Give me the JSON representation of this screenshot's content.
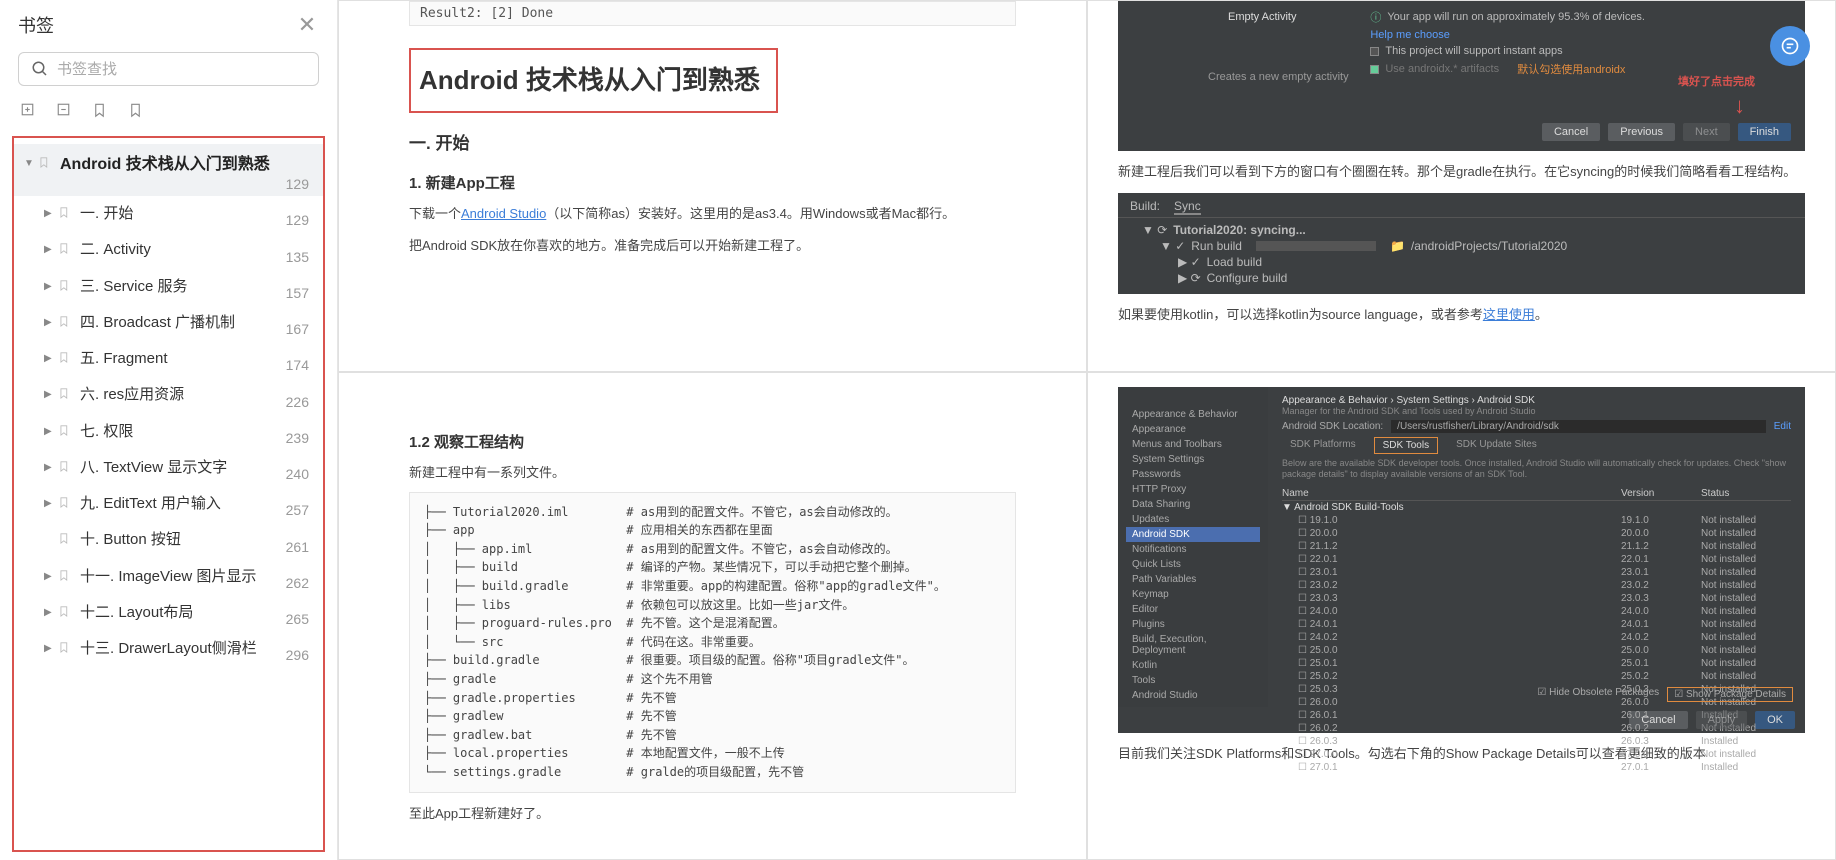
{
  "sidebar": {
    "title": "书签",
    "search_placeholder": "书签查找",
    "root": {
      "label": "Android 技术栈从入门到熟悉",
      "page": "129"
    },
    "items": [
      {
        "label": "一. 开始",
        "page": "129"
      },
      {
        "label": "二. Activity",
        "page": "135"
      },
      {
        "label": "三. Service 服务",
        "page": "157"
      },
      {
        "label": "四. Broadcast 广播机制",
        "page": "167"
      },
      {
        "label": "五. Fragment",
        "page": "174"
      },
      {
        "label": "六. res应用资源",
        "page": "226"
      },
      {
        "label": "七. 权限",
        "page": "239"
      },
      {
        "label": "八. TextView 显示文字",
        "page": "240"
      },
      {
        "label": "九. EditText 用户输入",
        "page": "257"
      },
      {
        "label": "十. Button 按钮",
        "page": "261",
        "noexpand": true
      },
      {
        "label": "十一. ImageView 图片显示",
        "page": "262"
      },
      {
        "label": "十二. Layout布局",
        "page": "265"
      },
      {
        "label": "十三. DrawerLayout侧滑栏",
        "page": "296"
      }
    ]
  },
  "article": {
    "code_result": "Result2: [2] Done",
    "title": "Android 技术栈从入门到熟悉",
    "h2_1": "一. 开始",
    "h3_1": "1. 新建App工程",
    "p1_a": "下载一个",
    "p1_link": "Android Studio",
    "p1_b": "（以下简称as）安装好。这里用的是as3.4。用Windows或者Mac都行。",
    "p2": "把Android SDK放在你喜欢的地方。准备完成后可以开始新建工程了。",
    "h3_2": "1.2 观察工程结构",
    "p3": "新建工程中有一系列文件。",
    "tree_text": "├── Tutorial2020.iml        # as用到的配置文件。不管它，as会自动修改的。\n├── app                     # 应用相关的东西都在里面\n│   ├── app.iml             # as用到的配置文件。不管它，as会自动修改的。\n│   ├── build               # 编译的产物。某些情况下，可以手动把它整个删掉。\n│   ├── build.gradle        # 非常重要。app的构建配置。俗称\"app的gradle文件\"。\n│   ├── libs                # 依赖包可以放这里。比如一些jar文件。\n│   ├── proguard-rules.pro  # 先不管。这个是混淆配置。\n│   └── src                 # 代码在这。非常重要。\n├── build.gradle            # 很重要。项目级的配置。俗称\"项目gradle文件\"。\n├── gradle                  # 这个先不用管\n├── gradle.properties       # 先不管\n├── gradlew                 # 先不管\n├── gradlew.bat             # 先不管\n├── local.properties        # 本地配置文件，一般不上传\n└── settings.gradle         # gralde的项目级配置，先不管",
    "p4": "至此App工程新建好了。"
  },
  "sc1": {
    "empty_activity": "Empty Activity",
    "approx": "Your app will run on approximately 95.3% of devices.",
    "help": "Help me choose",
    "instant": "This project will support instant apps",
    "use_androidx": "Use androidx.* artifacts",
    "androidx_note": "默认勾选使用androidx",
    "creates": "Creates a new empty activity",
    "done_note": "填好了点击完成",
    "btn_cancel": "Cancel",
    "btn_prev": "Previous",
    "btn_next": "Next",
    "btn_finish": "Finish",
    "after1": "新建工程后我们可以看到下方的窗口有个圈圈在转。那个是gradle在执行。在它syncing的时候我们简略看看工程结构。",
    "build_tab1": "Build:",
    "build_tab2": "Sync",
    "build_l1": "Tutorial2020: syncing...",
    "build_l2": "Run build",
    "build_l2r": "/androidProjects/Tutorial2020",
    "build_l3": "Load build",
    "build_l4": "Configure build",
    "kotlin_a": "如果要使用kotlin，可以选择kotlin为source language，或者参考",
    "kotlin_link": "这里使用",
    "kotlin_b": "。"
  },
  "sc2": {
    "crumb": "Appearance & Behavior  ›  System Settings  ›  Android SDK",
    "sub": "Manager for the Android SDK and Tools used by Android Studio",
    "loc_label": "Android SDK Location:",
    "loc_val": "/Users/rustfisher/Library/Android/sdk",
    "edit": "Edit",
    "left_items": [
      "Appearance & Behavior",
      "Appearance",
      "Menus and Toolbars",
      "System Settings",
      "Passwords",
      "HTTP Proxy",
      "Data Sharing",
      "Updates",
      "Android SDK",
      "Notifications",
      "Quick Lists",
      "Path Variables",
      "Keymap",
      "Editor",
      "Plugins",
      "Build, Execution, Deployment",
      "Kotlin",
      "Tools",
      "Android Studio"
    ],
    "tabs": [
      "SDK Platforms",
      "SDK Tools",
      "SDK Update Sites"
    ],
    "desc": "Below are the available SDK developer tools. Once installed, Android Studio will automatically check for updates. Check \"show package details\" to display available versions of an SDK Tool.",
    "col1": "Name",
    "col2": "Version",
    "col3": "Status",
    "section": "Android SDK Build-Tools",
    "rows": [
      [
        "19.1.0",
        "19.1.0",
        "Not installed"
      ],
      [
        "20.0.0",
        "20.0.0",
        "Not installed"
      ],
      [
        "21.1.2",
        "21.1.2",
        "Not installed"
      ],
      [
        "22.0.1",
        "22.0.1",
        "Not installed"
      ],
      [
        "23.0.1",
        "23.0.1",
        "Not installed"
      ],
      [
        "23.0.2",
        "23.0.2",
        "Not installed"
      ],
      [
        "23.0.3",
        "23.0.3",
        "Not installed"
      ],
      [
        "24.0.0",
        "24.0.0",
        "Not installed"
      ],
      [
        "24.0.1",
        "24.0.1",
        "Not installed"
      ],
      [
        "24.0.2",
        "24.0.2",
        "Not installed"
      ],
      [
        "25.0.0",
        "25.0.0",
        "Not installed"
      ],
      [
        "25.0.1",
        "25.0.1",
        "Not installed"
      ],
      [
        "25.0.2",
        "25.0.2",
        "Not installed"
      ],
      [
        "25.0.3",
        "25.0.3",
        "Not installed"
      ],
      [
        "26.0.0",
        "26.0.0",
        "Not installed"
      ],
      [
        "26.0.1",
        "26.0.1",
        "Installed"
      ],
      [
        "26.0.2",
        "26.0.2",
        "Not installed"
      ],
      [
        "26.0.3",
        "26.0.3",
        "Installed"
      ],
      [
        "27.0.0",
        "27.0.0",
        "Not installed"
      ],
      [
        "27.0.1",
        "27.0.1",
        "Installed"
      ]
    ],
    "hide": "Hide Obsolete Packages",
    "show": "Show Package Details",
    "btn_cancel": "Cancel",
    "btn_apply": "Apply",
    "btn_ok": "OK",
    "after": "目前我们关注SDK Platforms和SDK Tools。勾选右下角的Show Package Details可以查看更细致的版本"
  }
}
